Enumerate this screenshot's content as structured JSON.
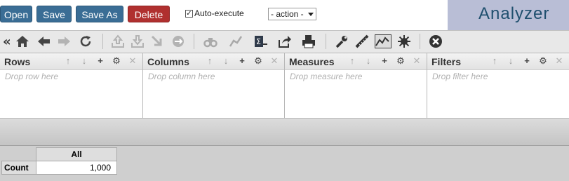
{
  "topbar": {
    "open_label": "Open",
    "save_label": "Save",
    "saveas_label": "Save As",
    "delete_label": "Delete",
    "autoexec_label": "Auto-execute",
    "autoexec_checked": true,
    "action_select_value": "- action -",
    "brand": "Analyzer"
  },
  "toolbar": {
    "icons": [
      "collapse-icon",
      "home-icon",
      "undo-icon",
      "redo-icon",
      "refresh-icon",
      "export-icon",
      "import-icon",
      "drill-icon",
      "link-icon",
      "find-icon",
      "chart-line-icon",
      "formula-icon",
      "share-icon",
      "print-icon",
      "wrench-icon",
      "ruler-icon",
      "chart-icon",
      "sunburst-icon",
      "close-circle-icon"
    ]
  },
  "panels": [
    {
      "title": "Rows",
      "placeholder": "Drop row here"
    },
    {
      "title": "Columns",
      "placeholder": "Drop column here"
    },
    {
      "title": "Measures",
      "placeholder": "Drop measure here"
    },
    {
      "title": "Filters",
      "placeholder": "Drop filter here"
    }
  ],
  "report": {
    "column_header": "All",
    "row_header": "Count",
    "value": "1,000"
  }
}
